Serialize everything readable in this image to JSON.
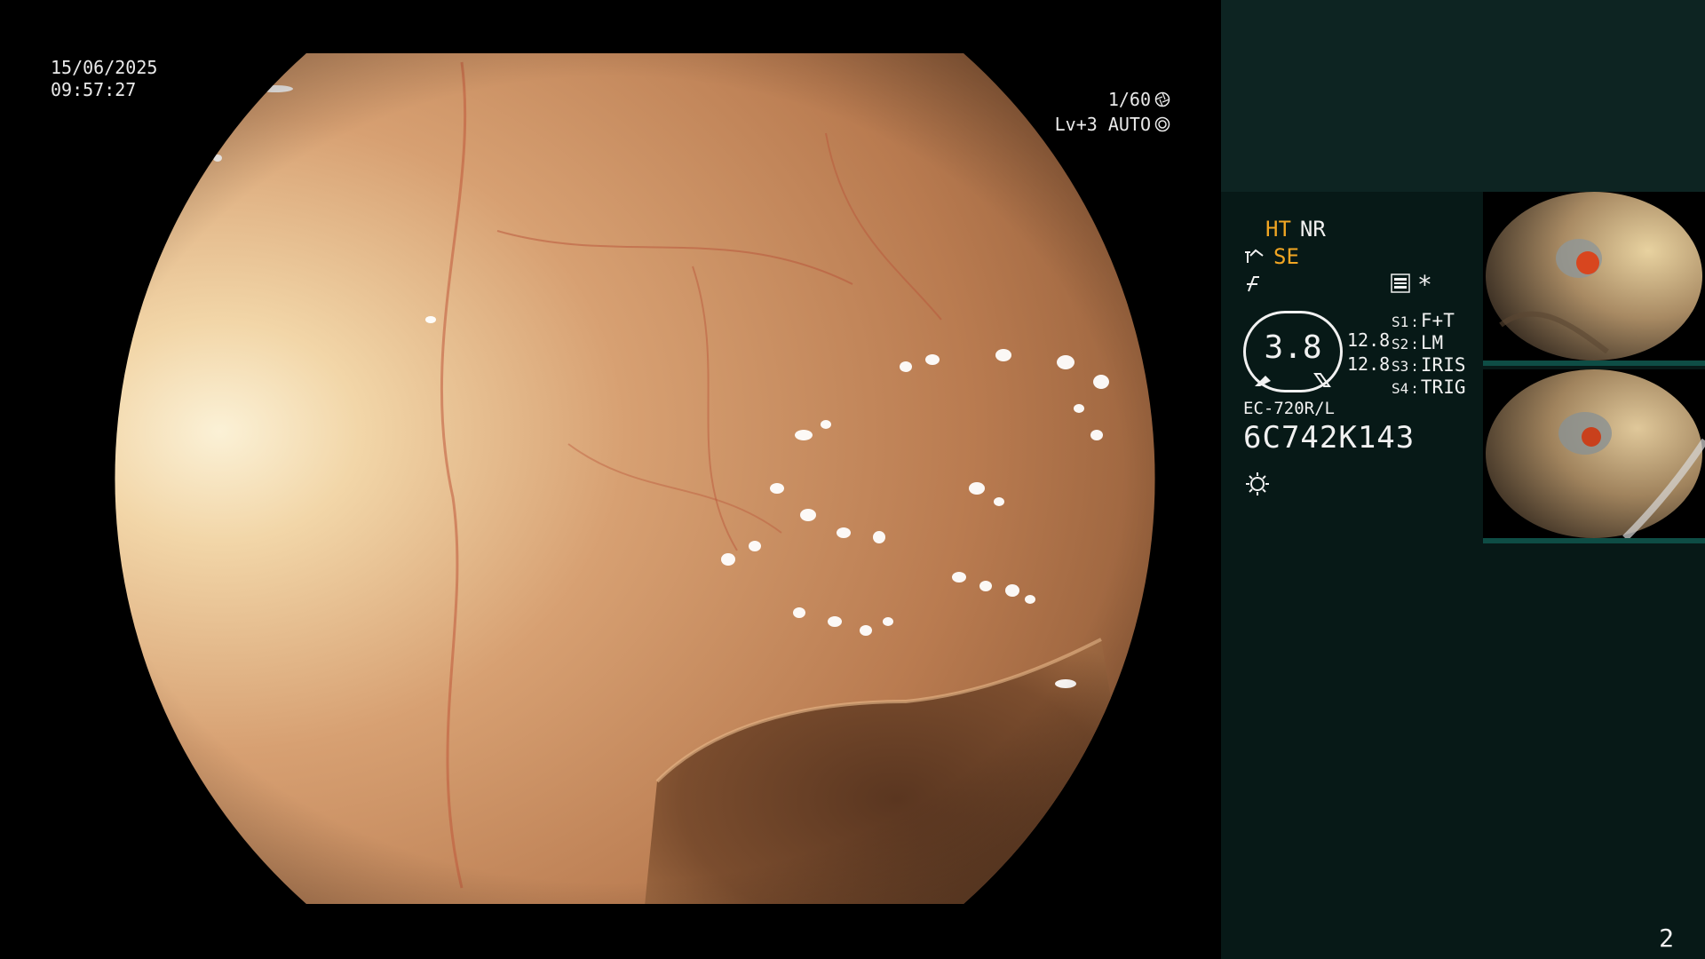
{
  "osd": {
    "date": "15/06/2025",
    "time": "09:57:27",
    "shutter": "1/60",
    "level": "Lv+3 AUTO"
  },
  "panel": {
    "mode_ht": "HT",
    "mode_nr": "NR",
    "mode_se": "SE",
    "asterisk": "*",
    "gauge_value": "3.8",
    "value_1": "12.8",
    "value_2": "12.8",
    "switches": [
      {
        "key": "S1",
        "value": "F+T"
      },
      {
        "key": "S2",
        "value": "LM"
      },
      {
        "key": "S3",
        "value": "IRIS"
      },
      {
        "key": "S4",
        "value": "TRIG"
      }
    ],
    "model": "EC-720R/L",
    "serial": "6C742K143",
    "page_number": "2"
  },
  "colors": {
    "panel_bg": "#071917",
    "panel_top_bg": "#0d2422",
    "amber": "#f2a623",
    "osd_text": "#eaeaea"
  },
  "icons": [
    "aperture-icon",
    "iris-icon",
    "scope-icon",
    "enhance-icon",
    "record-icon",
    "light-icon"
  ]
}
